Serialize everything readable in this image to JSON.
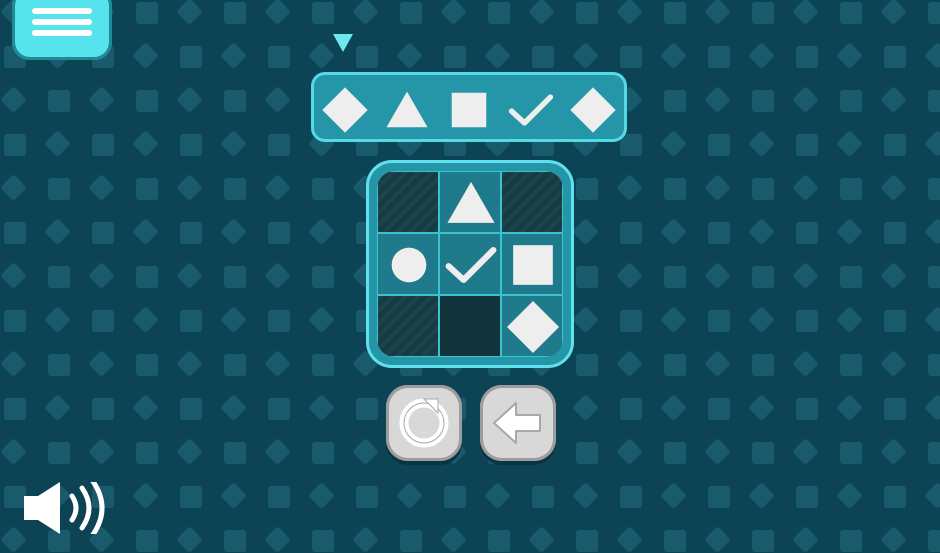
{
  "palette": {
    "background": "#0c4456",
    "tile": "#195a6c",
    "accent": "#54d9e6",
    "panel": "#2596a8",
    "shape": "#eeeeee",
    "button": "#d8d8d8"
  },
  "sequence": {
    "current_index": 0,
    "items": [
      "diamond",
      "triangle",
      "square",
      "check",
      "diamond"
    ]
  },
  "board": {
    "rows": 3,
    "cols": 3,
    "cells": [
      [
        "empty",
        "triangle",
        "empty"
      ],
      [
        "circle",
        "check",
        "square"
      ],
      [
        "empty",
        "empty",
        "diamond"
      ]
    ]
  },
  "controls": {
    "restart_icon": "restart-icon",
    "undo_icon": "arrow-left-icon"
  },
  "menu_icon": "hamburger-icon",
  "sound_icon": "speaker-icon"
}
